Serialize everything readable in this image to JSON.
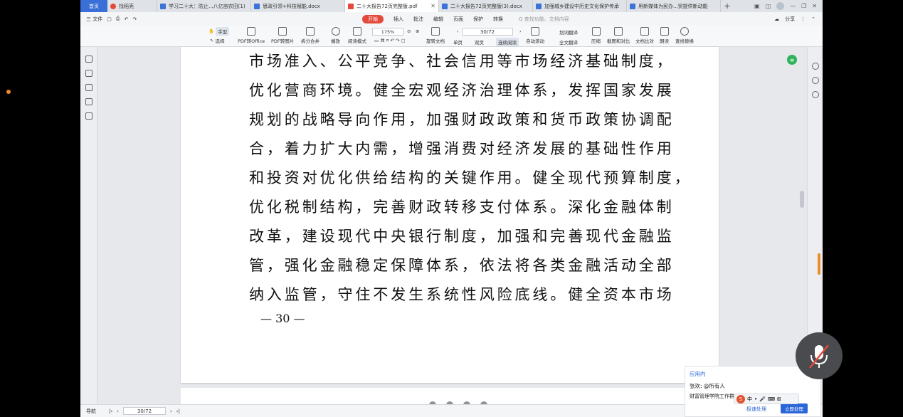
{
  "tabs": {
    "home": "首页",
    "items": [
      {
        "label": "找稻壳",
        "icon": "wps"
      },
      {
        "label": "学习二十大：防止...八亿亩农田(1)",
        "icon": "doc"
      },
      {
        "label": "思政引领+科技赋能.docx",
        "icon": "doc"
      },
      {
        "label": "二十大报告72页完整版.pdf",
        "icon": "pdf",
        "active": true
      },
      {
        "label": "二十大报告72页完整版(3).docx",
        "icon": "doc"
      },
      {
        "label": "加强城乡建设中历史文化保护传承",
        "icon": "doc"
      },
      {
        "label": "用新媒体为民办...贸提供新动能",
        "icon": "doc"
      }
    ],
    "add": "+"
  },
  "menu": {
    "file": "三 文件",
    "items": [
      "开始",
      "插入",
      "批注",
      "编辑",
      "页面",
      "保护",
      "转换"
    ],
    "active": "开始",
    "search": "Q 查找功能、文档内容",
    "share": "分享"
  },
  "toolbar": {
    "hand": "手型",
    "select": "选择",
    "pdf_office": "PDF转Office",
    "pdf_image": "PDF转图片",
    "split_merge": "拆分合并",
    "play": "播放",
    "read_mode": "阅读模式",
    "zoom": "175%",
    "rotate": "旋转文档",
    "single": "单页",
    "double": "双页",
    "continuous": "连续阅读",
    "auto_scroll": "自动滚动",
    "page": "30/72",
    "translate": "划词翻译",
    "full_translate": "全文翻译",
    "compress": "压缩",
    "screenshot": "截图和对比",
    "compare": "文档比对",
    "read_aloud": "朗读",
    "find_replace": "查找替换"
  },
  "document": {
    "lines": [
      "市场准入、公平竞争、社会信用等市场经济基础制度，",
      "优化营商环境。健全宏观经济治理体系，发挥国家发展",
      "规划的战略导向作用，加强财政政策和货币政策协调配",
      "合，着力扩大内需，增强消费对经济发展的基础性作用",
      "和投资对优化供给结构的关键作用。健全现代预算制度，",
      "优化税制结构，完善财政转移支付体系。深化金融体制",
      "改革，建设现代中央银行制度，加强和完善现代金融监",
      "管，强化金融稳定保障体系，依法将各类金融活动全部",
      "纳入监管，守住不发生系统性风险底线。健全资本市场"
    ],
    "page_number": "— 30 —"
  },
  "statusbar": {
    "nav": "导航",
    "page": "30/72"
  },
  "notification": {
    "title": "应用内",
    "line1": "张欢: @所有人",
    "line2": "财富管理学院工作群",
    "line3": "极速处理",
    "button": "立即处理"
  },
  "ime": {
    "label": "中"
  }
}
